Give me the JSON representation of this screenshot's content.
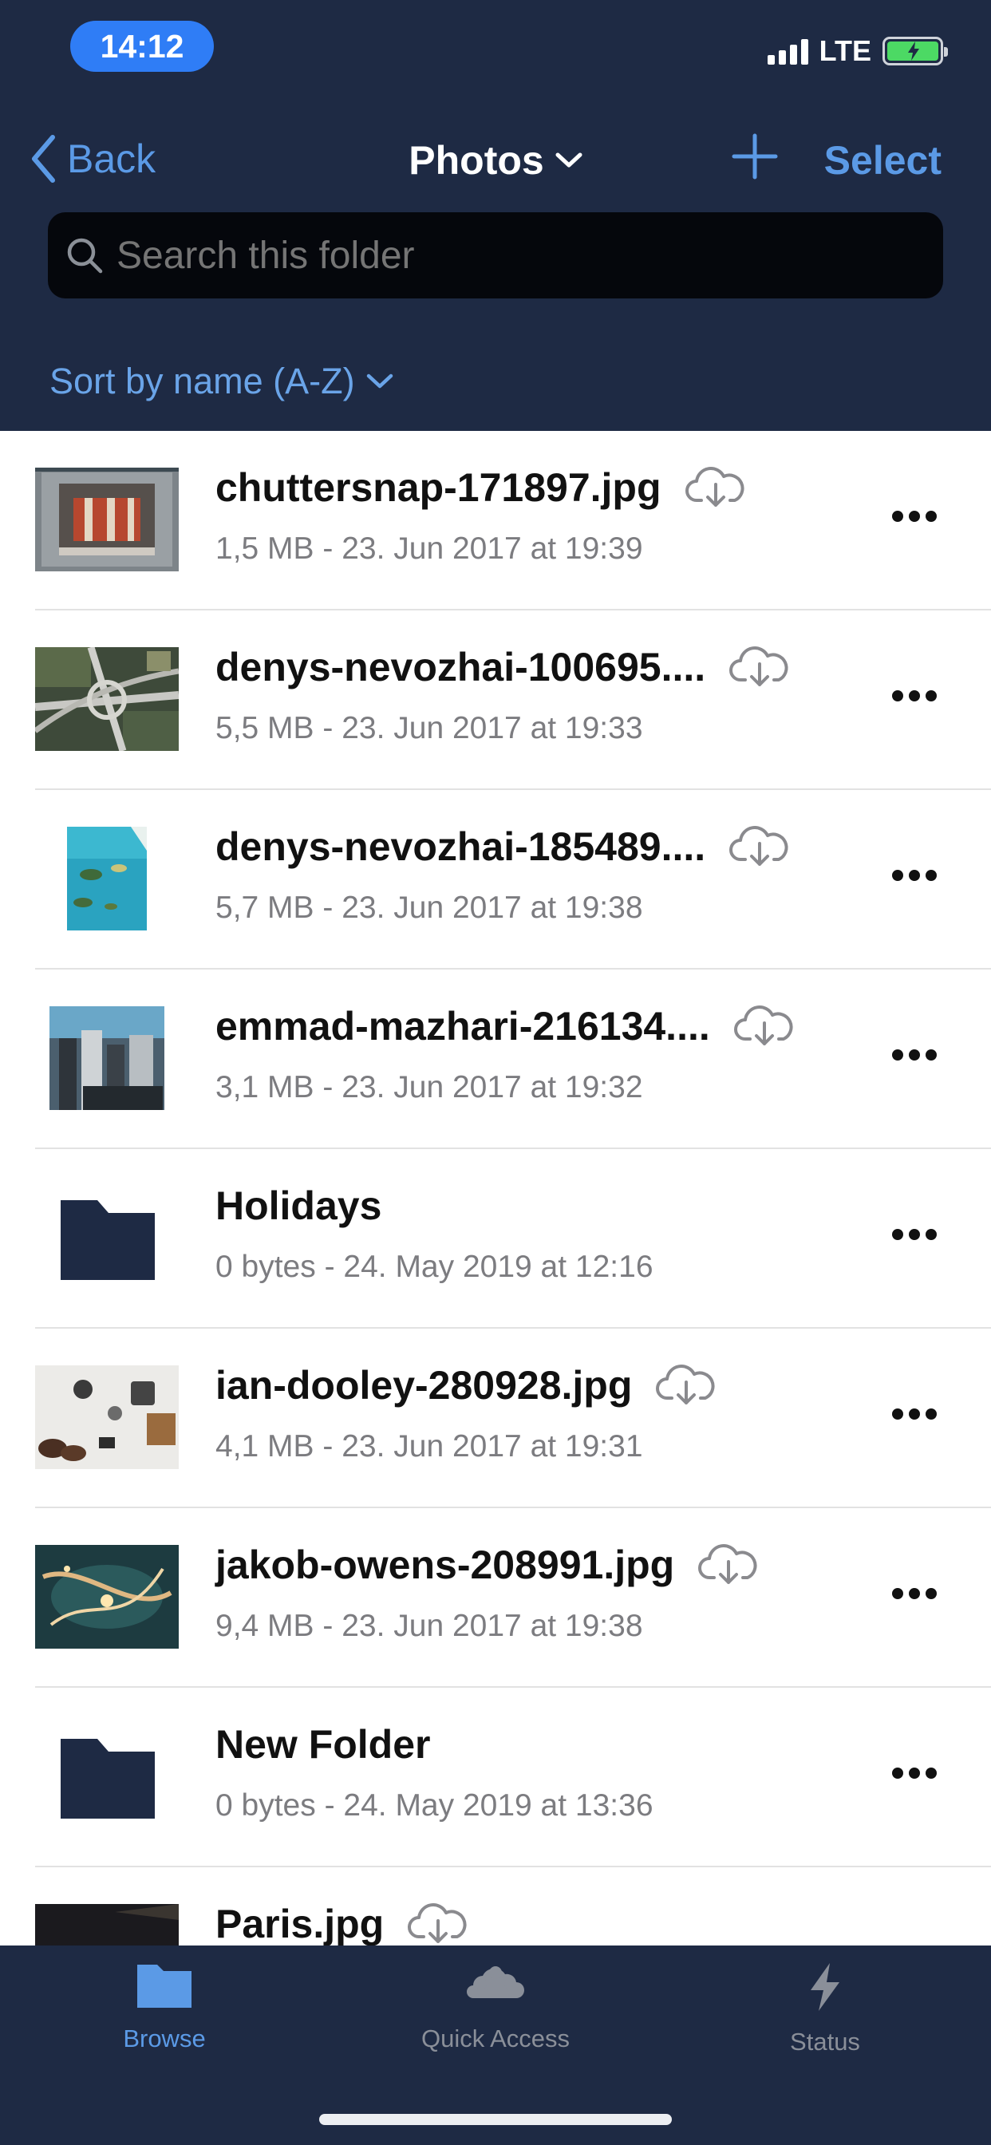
{
  "status_bar": {
    "time": "14:12",
    "network": "LTE"
  },
  "nav": {
    "back_label": "Back",
    "title": "Photos",
    "select_label": "Select"
  },
  "search": {
    "placeholder": "Search this folder"
  },
  "sort": {
    "label": "Sort by name (A-Z)"
  },
  "files": [
    {
      "name": "chuttersnap-171897.jpg",
      "meta": "1,5 MB - 23. Jun 2017 at 19:39",
      "kind": "image",
      "cloud": true
    },
    {
      "name": "denys-nevozhai-100695....",
      "meta": "5,5 MB - 23. Jun 2017 at 19:33",
      "kind": "image",
      "cloud": true
    },
    {
      "name": "denys-nevozhai-185489....",
      "meta": "5,7 MB - 23. Jun 2017 at 19:38",
      "kind": "image",
      "cloud": true
    },
    {
      "name": "emmad-mazhari-216134....",
      "meta": "3,1 MB - 23. Jun 2017 at 19:32",
      "kind": "image",
      "cloud": true
    },
    {
      "name": "Holidays",
      "meta": "0 bytes - 24. May 2019 at 12:16",
      "kind": "folder",
      "cloud": false
    },
    {
      "name": "ian-dooley-280928.jpg",
      "meta": "4,1 MB - 23. Jun 2017 at 19:31",
      "kind": "image",
      "cloud": true
    },
    {
      "name": "jakob-owens-208991.jpg",
      "meta": "9,4 MB - 23. Jun 2017 at 19:38",
      "kind": "image",
      "cloud": true
    },
    {
      "name": "New Folder",
      "meta": "0 bytes - 24. May 2019 at 13:36",
      "kind": "folder",
      "cloud": false
    },
    {
      "name": "Paris.jpg",
      "meta": "",
      "kind": "image",
      "cloud": true
    }
  ],
  "tabs": [
    {
      "label": "Browse",
      "icon": "folder-icon",
      "active": true
    },
    {
      "label": "Quick Access",
      "icon": "cloud-icon",
      "active": false
    },
    {
      "label": "Status",
      "icon": "lightning-icon",
      "active": false
    }
  ],
  "colors": {
    "header_bg": "#1e2a44",
    "accent": "#5b9ae6",
    "active_tab": "#5b9ae6",
    "inactive_tab": "#8a8f99",
    "time_pill": "#2f7df6"
  }
}
